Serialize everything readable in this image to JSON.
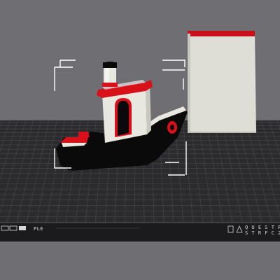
{
  "view": {
    "background_color": "#6f6f73",
    "bed_color": "#2b2b2d",
    "grid_color": "#4a4a4e",
    "bed_edge_color": "#1e1e20",
    "accent_color": "#d8101a"
  },
  "bed": {
    "front_label_left": "PLE",
    "front_label_right": "Q U E S T R",
    "front_label_right_sub": "S T R F C 2"
  },
  "objects": [
    {
      "name": "benchy-boat",
      "selected": true,
      "hull_color": "#0a0a0a",
      "cabin_color": "#e8e8e0",
      "trim_color": "#d8101a"
    },
    {
      "name": "wipe-tower",
      "selected": false,
      "body_color": "#deded6",
      "top_color": "#c8101a"
    }
  ],
  "icons": {
    "selection": "bounding-box-corner-icon",
    "bed_logo": "printer-brand-icon"
  }
}
